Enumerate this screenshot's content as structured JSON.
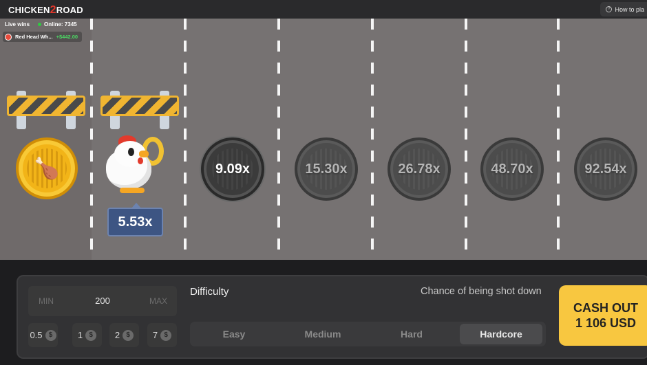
{
  "header": {
    "logo_text_a": "CHICKEN",
    "logo_text_b": "2",
    "logo_text_c": "ROAD",
    "how_to_play": "How to pla"
  },
  "live": {
    "label": "Live wins",
    "online": "Online: 7345",
    "winner_name": "Red Head Wh...",
    "winner_amount": "+$442.00"
  },
  "game": {
    "current_multiplier": "5.53x",
    "multipliers": [
      "9.09x",
      "15.30x",
      "26.78x",
      "48.70x",
      "92.54x"
    ],
    "coin_icon": "chicken-leg-icon",
    "barrier_icon": "road-barrier"
  },
  "bet": {
    "min_label": "MIN",
    "value": "200",
    "max_label": "MAX",
    "quick_amounts": [
      "0.5",
      "1",
      "2",
      "7"
    ],
    "currency_icon": "$"
  },
  "difficulty": {
    "label": "Difficulty",
    "chance_label": "Chance of being shot down",
    "options": [
      "Easy",
      "Medium",
      "Hard",
      "Hardcore"
    ],
    "selected": "Hardcore"
  },
  "cashout": {
    "line1": "CASH OUT",
    "line2": "1 106 USD"
  },
  "colors": {
    "road": "#767272",
    "accent": "#f8c740",
    "badge": "#3d5583",
    "win_green": "#4cd964"
  }
}
